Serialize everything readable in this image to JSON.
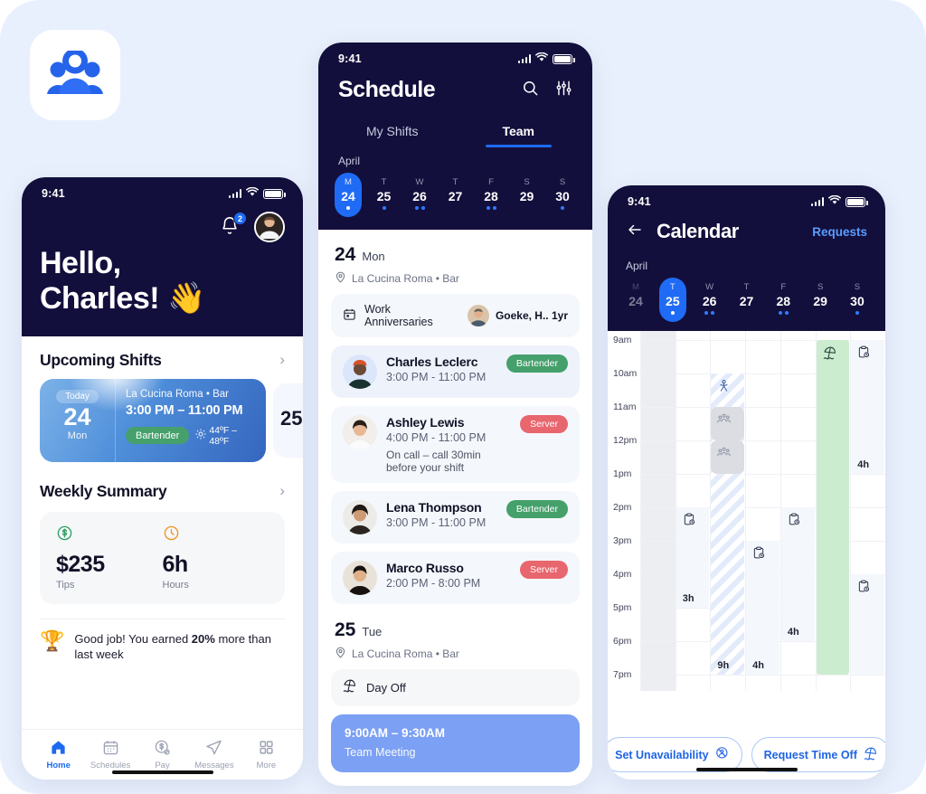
{
  "brand": {
    "logo_icon": "people-group-icon"
  },
  "phone1": {
    "status": {
      "time": "9:41",
      "signal_icon": "cellular-bars-icon",
      "wifi_icon": "wifi-icon",
      "battery_icon": "battery-full-icon"
    },
    "header": {
      "bell_icon": "bell-icon",
      "notification_count": "2",
      "avatar_icon": "user-avatar",
      "greeting_line1": "Hello,",
      "greeting_line2": "Charles!",
      "wave_emoji": "👋"
    },
    "upcoming": {
      "title": "Upcoming Shifts",
      "chevron_icon": "chevron-right-icon",
      "card": {
        "today_label": "Today",
        "day_number": "24",
        "day_name": "Mon",
        "location": "La Cucina Roma  •  Bar",
        "time": "3:00 PM – 11:00 PM",
        "role": "Bartender",
        "weather_icon": "sun-icon",
        "weather": "44ºF – 48ºF"
      },
      "next_card_peek": "25"
    },
    "weekly": {
      "title": "Weekly Summary",
      "chevron_icon": "chevron-right-icon",
      "stats": [
        {
          "icon": "dollar-circle-icon",
          "value": "$235",
          "label": "Tips",
          "color": "#2f9e63"
        },
        {
          "icon": "clock-icon",
          "value": "6h",
          "label": "Hours",
          "color": "#f0941f"
        }
      ]
    },
    "goodjob": {
      "trophy_icon": "🏆",
      "text_before": "Good job! You earned ",
      "highlight": "20%",
      "text_after": " more than last week"
    },
    "tabbar": [
      {
        "icon": "home-icon",
        "label": "Home",
        "active": true
      },
      {
        "icon": "calendar-icon",
        "label": "Schedules",
        "active": false
      },
      {
        "icon": "pay-dollar-icon",
        "label": "Pay",
        "active": false
      },
      {
        "icon": "send-message-icon",
        "label": "Messages",
        "active": false
      },
      {
        "icon": "grid-more-icon",
        "label": "More",
        "active": false
      }
    ]
  },
  "phone2": {
    "status": {
      "time": "9:41"
    },
    "header": {
      "title": "Schedule",
      "search_icon": "search-icon",
      "filter_icon": "sliders-filter-icon"
    },
    "tabs": [
      {
        "label": "My Shifts",
        "active": false
      },
      {
        "label": "Team",
        "active": true
      }
    ],
    "datestrip": {
      "month": "April",
      "days": [
        {
          "dow": "M",
          "num": "24",
          "dots": 1,
          "selected": true
        },
        {
          "dow": "T",
          "num": "25",
          "dots": 1,
          "selected": false
        },
        {
          "dow": "W",
          "num": "26",
          "dots": 2,
          "selected": false
        },
        {
          "dow": "T",
          "num": "27",
          "dots": 0,
          "selected": false
        },
        {
          "dow": "F",
          "num": "28",
          "dots": 2,
          "selected": false
        },
        {
          "dow": "S",
          "num": "29",
          "dots": 0,
          "selected": false
        },
        {
          "dow": "S",
          "num": "30",
          "dots": 1,
          "selected": false
        }
      ]
    },
    "day24": {
      "num": "24",
      "dow": "Mon",
      "location_icon": "location-pin-icon",
      "location": "La Cucina Roma  •  Bar",
      "anniversary": {
        "icon": "calendar-icon",
        "label": "Work Anniversaries",
        "person": "Goeke, H.. 1yr"
      },
      "shifts": [
        {
          "name": "Charles Leclerc",
          "time": "3:00 PM - 11:00 PM",
          "note": "",
          "badge": "Bartender",
          "badge_type": "bartender",
          "highlight": true
        },
        {
          "name": "Ashley Lewis",
          "time": "4:00 PM - 11:00 PM",
          "note": "On call – call 30min before your shift",
          "badge": "Server",
          "badge_type": "server",
          "highlight": false
        },
        {
          "name": "Lena Thompson",
          "time": "3:00 PM - 11:00 PM",
          "note": "",
          "badge": "Bartender",
          "badge_type": "bartender",
          "highlight": false
        },
        {
          "name": "Marco Russo",
          "time": "2:00 PM - 8:00 PM",
          "note": "",
          "badge": "Server",
          "badge_type": "server",
          "highlight": false
        }
      ]
    },
    "day25": {
      "num": "25",
      "dow": "Tue",
      "location_icon": "location-pin-icon",
      "location": "La Cucina Roma  •  Bar",
      "dayoff": {
        "icon": "beach-umbrella-icon",
        "label": "Day Off"
      },
      "meeting": {
        "time": "9:00AM – 9:30AM",
        "name": "Team Meeting"
      }
    }
  },
  "phone3": {
    "status": {
      "time": "9:41"
    },
    "header": {
      "back_icon": "arrow-left-icon",
      "title": "Calendar",
      "requests_label": "Requests"
    },
    "datestrip": {
      "month": "April",
      "days": [
        {
          "dow": "M",
          "num": "24",
          "dots": 0,
          "selected": false,
          "dim": true
        },
        {
          "dow": "T",
          "num": "25",
          "dots": 1,
          "selected": true
        },
        {
          "dow": "W",
          "num": "26",
          "dots": 2,
          "selected": false
        },
        {
          "dow": "T",
          "num": "27",
          "dots": 0,
          "selected": false
        },
        {
          "dow": "F",
          "num": "28",
          "dots": 2,
          "selected": false
        },
        {
          "dow": "S",
          "num": "29",
          "dots": 0,
          "selected": false
        },
        {
          "dow": "S",
          "num": "30",
          "dots": 1,
          "selected": false
        }
      ]
    },
    "grid": {
      "hours": [
        "9am",
        "10am",
        "11am",
        "12pm",
        "1pm",
        "2pm",
        "3pm",
        "4pm",
        "5pm",
        "6pm",
        "7pm"
      ],
      "events": [
        {
          "col": 1,
          "start": "2pm",
          "end": "5pm",
          "hours_label": "3h",
          "icon": "clipboard-clock-icon",
          "style": "light"
        },
        {
          "col": 2,
          "start": "10am",
          "end": "7pm",
          "hours_label": "9h",
          "icon": "unavailable-person-icon",
          "style": "striped"
        },
        {
          "col": 3,
          "start": "3pm",
          "end": "7pm",
          "hours_label": "4h",
          "icon": "clipboard-clock-icon",
          "style": "light"
        },
        {
          "col": 4,
          "start": "2pm",
          "end": "6pm",
          "hours_label": "4h",
          "icon": "clipboard-clock-icon",
          "style": "light"
        },
        {
          "col": 5,
          "start": "9am",
          "end": "7pm",
          "hours_label": "",
          "icon": "beach-umbrella-icon",
          "style": "green"
        },
        {
          "col": 6,
          "start": "9am",
          "end": "1pm",
          "hours_label": "4h",
          "icon": "clipboard-clock-icon",
          "style": "light"
        },
        {
          "col": 6,
          "start": "4pm",
          "end": "7pm",
          "hours_label": "",
          "icon": "clipboard-clock-icon",
          "style": "light"
        }
      ],
      "meetings": [
        {
          "col": 2,
          "start": "11am",
          "end": "12pm",
          "icon": "team-meeting-icon"
        },
        {
          "col": 2,
          "start": "12pm",
          "end": "1pm",
          "icon": "team-meeting-icon"
        }
      ]
    },
    "actions": [
      {
        "label": "Set Unavailability",
        "icon": "no-availability-icon"
      },
      {
        "label": "Request Time Off",
        "icon": "beach-umbrella-icon"
      }
    ]
  }
}
